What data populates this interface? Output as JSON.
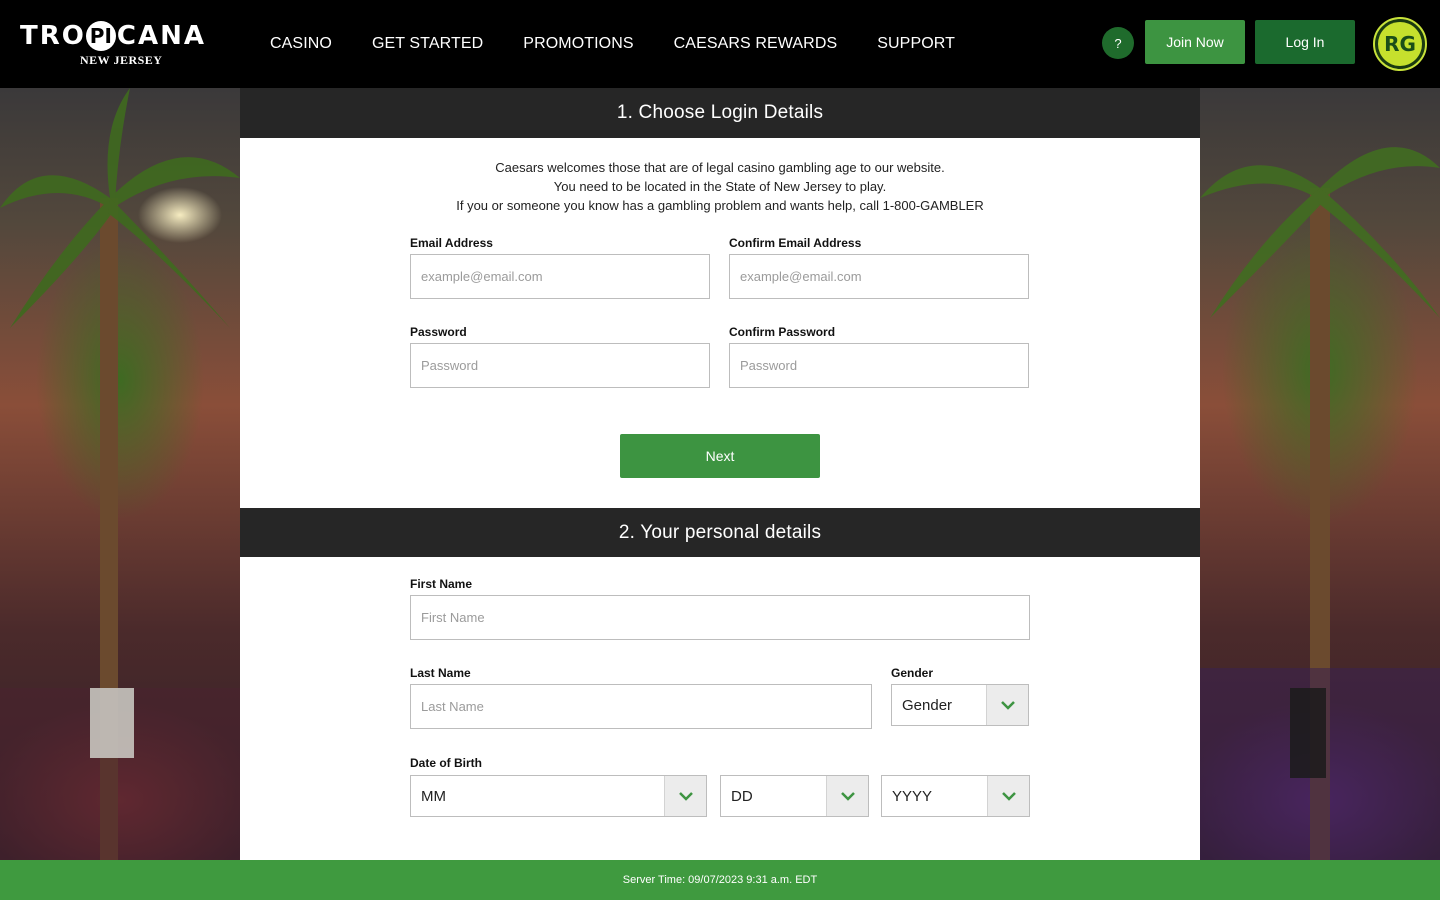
{
  "brand": {
    "name_part1": "TRO",
    "name_circle": "PI",
    "name_part2": "CANA",
    "sub": "NEW JERSEY",
    "rg_badge": "RG",
    "accent": "#3d9441",
    "dark_green": "#1b6a2e"
  },
  "nav": {
    "items": [
      "CASINO",
      "GET STARTED",
      "PROMOTIONS",
      "CAESARS REWARDS",
      "SUPPORT"
    ]
  },
  "header_actions": {
    "help": "?",
    "join": "Join Now",
    "login": "Log In"
  },
  "section1": {
    "title": "1. Choose Login Details",
    "intro": [
      "Caesars welcomes those that are of legal casino gambling age to our website.",
      "You need to be located in the State of New Jersey to play.",
      "If you or someone you know has a gambling problem and wants help, call 1-800-GAMBLER"
    ],
    "email_label": "Email Address",
    "email_placeholder": "example@email.com",
    "confirm_email_label": "Confirm Email Address",
    "confirm_email_placeholder": "example@email.com",
    "password_label": "Password",
    "password_placeholder": "Password",
    "confirm_password_label": "Confirm Password",
    "confirm_password_placeholder": "Password",
    "next": "Next"
  },
  "section2": {
    "title": "2. Your personal details",
    "first_name_label": "First Name",
    "first_name_placeholder": "First Name",
    "last_name_label": "Last Name",
    "last_name_placeholder": "Last Name",
    "gender_label": "Gender",
    "gender_value": "Gender",
    "dob_label": "Date of Birth",
    "dob_month": "MM",
    "dob_day": "DD",
    "dob_year": "YYYY"
  },
  "footer": {
    "server_time": "Server Time: 09/07/2023 9:31 a.m. EDT"
  }
}
